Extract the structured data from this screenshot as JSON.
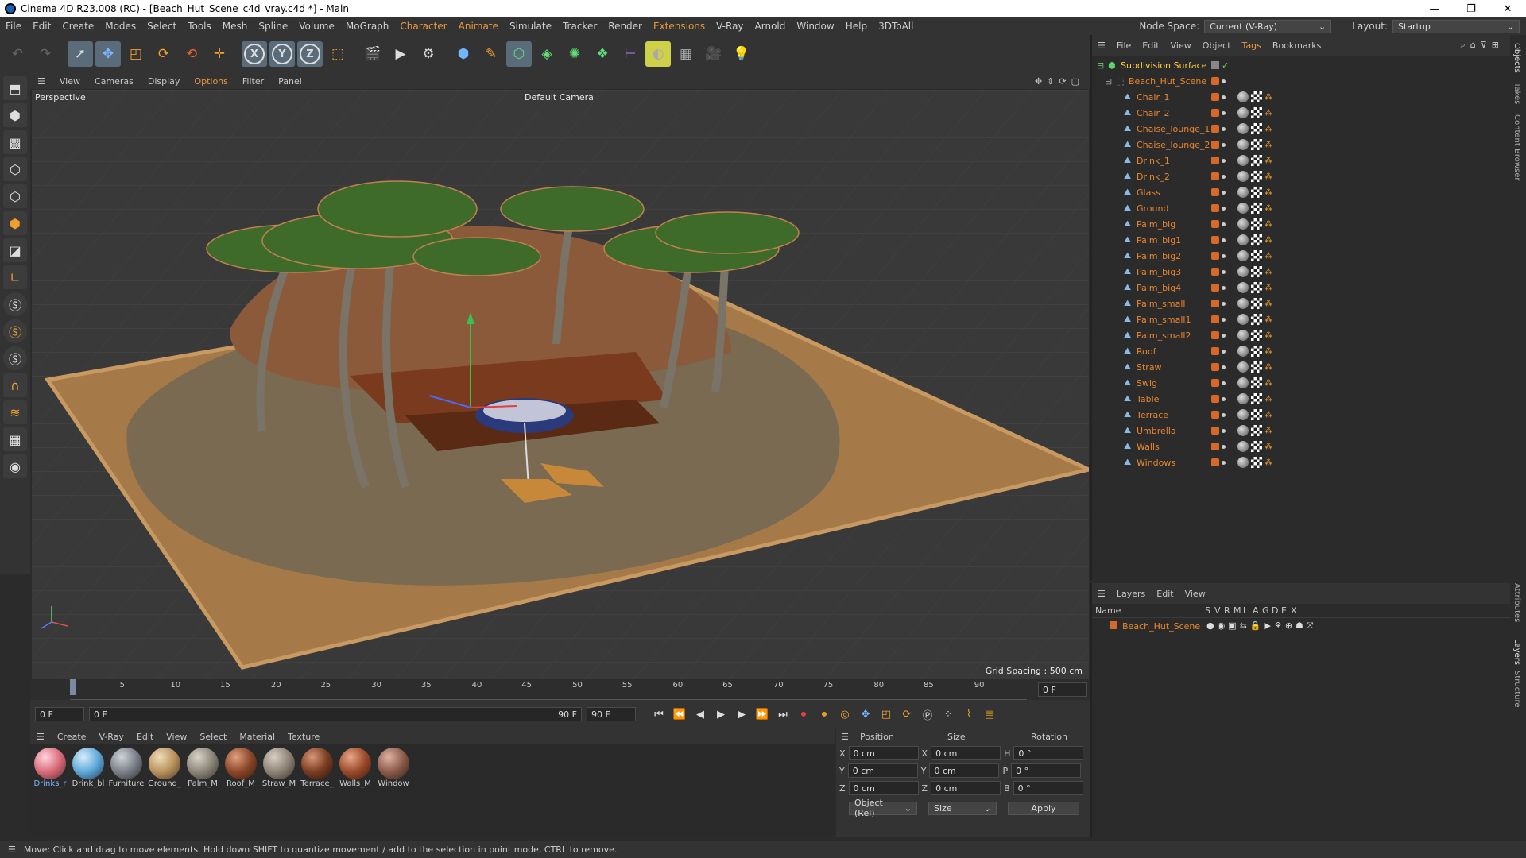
{
  "window": {
    "title": "Cinema 4D R23.008 (RC) - [Beach_Hut_Scene_c4d_vray.c4d *] - Main",
    "minimize": "—",
    "maximize": "❐",
    "close": "✕"
  },
  "menu": [
    "File",
    "Edit",
    "Create",
    "Modes",
    "Select",
    "Tools",
    "Mesh",
    "Spline",
    "Volume",
    "MoGraph",
    "Character",
    "Animate",
    "Simulate",
    "Tracker",
    "Render",
    "Extensions",
    "V-Ray",
    "Arnold",
    "Window",
    "Help",
    "3DToAll"
  ],
  "node_space": {
    "label": "Node Space:",
    "value": "Current (V-Ray)"
  },
  "layout": {
    "label": "Layout:",
    "value": "Startup"
  },
  "viewport": {
    "menu": [
      "View",
      "Cameras",
      "Display",
      "Options",
      "Filter",
      "Panel"
    ],
    "view_name": "Perspective",
    "camera": "Default Camera",
    "grid_spacing": "Grid Spacing : 500 cm"
  },
  "timeline": {
    "ticks": [
      "0",
      "5",
      "10",
      "15",
      "20",
      "25",
      "30",
      "35",
      "40",
      "45",
      "50",
      "55",
      "60",
      "65",
      "70",
      "75",
      "80",
      "85",
      "90"
    ],
    "current": "0 F",
    "start": "0 F",
    "range_start": "0 F",
    "range_end": "90 F",
    "end": "90 F",
    "right_field": "0 F"
  },
  "materials": {
    "menu": [
      "Create",
      "V-Ray",
      "Edit",
      "View",
      "Select",
      "Material",
      "Texture"
    ],
    "items": [
      {
        "name": "Drinks_r",
        "color": "#d96a7a"
      },
      {
        "name": "Drink_bl",
        "color": "#5fa8d8"
      },
      {
        "name": "Furniture",
        "color": "#7a7f88"
      },
      {
        "name": "Ground_",
        "color": "#b8925e"
      },
      {
        "name": "Palm_M",
        "color": "#8a8577"
      },
      {
        "name": "Roof_M",
        "color": "#8a4628"
      },
      {
        "name": "Straw_M",
        "color": "#8d8275"
      },
      {
        "name": "Terrace_",
        "color": "#7a3c22"
      },
      {
        "name": "Walls_M",
        "color": "#9a4a2a"
      },
      {
        "name": "Window",
        "color": "#8a5a4a"
      }
    ]
  },
  "coords": {
    "headers": [
      "Position",
      "Size",
      "Rotation"
    ],
    "rows": [
      {
        "a": "X",
        "pos": "0 cm",
        "b": "X",
        "size": "0 cm",
        "c": "H",
        "rot": "0 °"
      },
      {
        "a": "Y",
        "pos": "0 cm",
        "b": "Y",
        "size": "0 cm",
        "c": "P",
        "rot": "0 °"
      },
      {
        "a": "Z",
        "pos": "0 cm",
        "b": "Z",
        "size": "0 cm",
        "c": "B",
        "rot": "0 °"
      }
    ],
    "mode": "Object (Rel)",
    "size_mode": "Size",
    "apply": "Apply"
  },
  "status": "Move: Click and drag to move elements. Hold down SHIFT to quantize movement / add to the selection in point mode, CTRL to remove.",
  "objects": {
    "menu": [
      "File",
      "Edit",
      "View",
      "Object",
      "Tags",
      "Bookmarks"
    ],
    "root": "Subdivision Surface",
    "scene": "Beach_Hut_Scene",
    "items": [
      "Chair_1",
      "Chair_2",
      "Chaise_lounge_1",
      "Chaise_lounge_2",
      "Drink_1",
      "Drink_2",
      "Glass",
      "Ground",
      "Palm_big",
      "Palm_big1",
      "Palm_big2",
      "Palm_big3",
      "Palm_big4",
      "Palm_small",
      "Palm_small1",
      "Palm_small2",
      "Roof",
      "Straw",
      "Swig",
      "Table",
      "Terrace",
      "Umbrella",
      "Walls",
      "Windows"
    ]
  },
  "layers": {
    "menu": [
      "Layers",
      "Edit",
      "View"
    ],
    "name_header": "Name",
    "cols": [
      "S",
      "V",
      "R",
      "M",
      "L",
      "A",
      "G",
      "D",
      "E",
      "X"
    ],
    "layer": "Beach_Hut_Scene"
  },
  "sidetabs": [
    "Objects",
    "Takes",
    "Content Browser",
    "Attributes",
    "Layers",
    "Structure"
  ],
  "accent": "#e89a3c"
}
